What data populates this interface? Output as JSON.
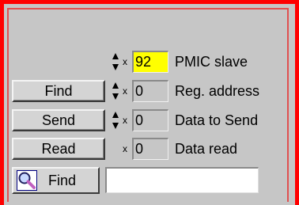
{
  "buttons": {
    "find": "Find",
    "send": "Send",
    "read": "Read",
    "search_find": "Find"
  },
  "fields": [
    {
      "name": "pmic-slave",
      "radix": "x",
      "value": "92",
      "label": "PMIC slave",
      "has_spinner": true,
      "highlight": "#ffff00"
    },
    {
      "name": "reg-address",
      "radix": "x",
      "value": "0",
      "label": "Reg. address",
      "has_spinner": true
    },
    {
      "name": "data-to-send",
      "radix": "x",
      "value": "0",
      "label": "Data to Send",
      "has_spinner": true
    },
    {
      "name": "data-read",
      "radix": "x",
      "value": "0",
      "label": "Data read",
      "has_spinner": false
    }
  ],
  "search": {
    "value": "",
    "icon": "magnifier-icon"
  },
  "colors": {
    "frame_border": "#ff0000",
    "panel_background": "#c6c6c6",
    "highlight": "#ffff00"
  }
}
